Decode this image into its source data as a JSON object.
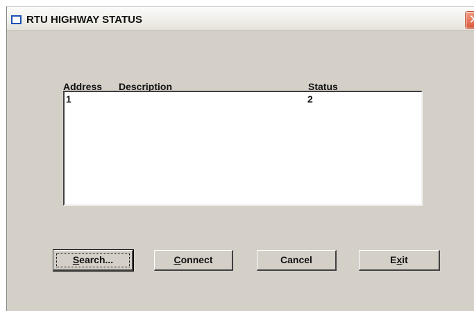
{
  "window": {
    "title": "RTU HIGHWAY STATUS",
    "close_glyph": "✕"
  },
  "columns": {
    "address": {
      "mnemonic": "A",
      "rest": "ddress"
    },
    "description": "Description",
    "status": "Status"
  },
  "rows": [
    {
      "address": "1",
      "description": "",
      "status": "2"
    }
  ],
  "buttons": {
    "search": {
      "mnemonic": "S",
      "rest": "earch..."
    },
    "connect": {
      "mnemonic": "C",
      "rest": "onnect"
    },
    "cancel": {
      "label": "Cancel"
    },
    "exit": {
      "before": "E",
      "mnemonic": "x",
      "after": "it"
    }
  },
  "colors": {
    "dialog_face": "#d4d0c8",
    "title_icon_blue": "#1c4fb4",
    "close_red": "#d95b3e"
  }
}
